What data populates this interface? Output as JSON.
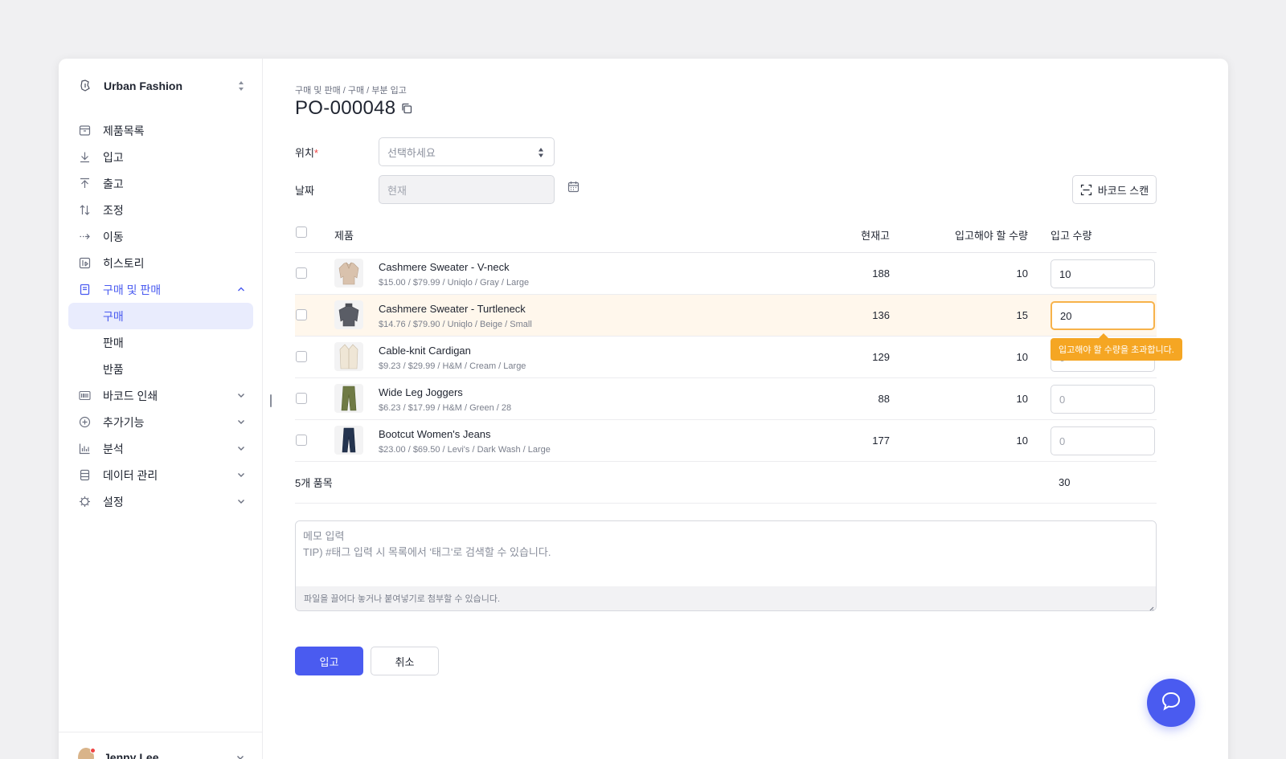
{
  "sidebar": {
    "brand": "Urban Fashion",
    "items": [
      {
        "label": "제품목록",
        "icon": "box-icon"
      },
      {
        "label": "입고",
        "icon": "arrow-down-icon"
      },
      {
        "label": "출고",
        "icon": "arrow-up-icon"
      },
      {
        "label": "조정",
        "icon": "swap-vertical-icon"
      },
      {
        "label": "이동",
        "icon": "arrow-right-icon"
      },
      {
        "label": "히스토리",
        "icon": "history-icon"
      },
      {
        "label": "구매 및 판매",
        "icon": "document-icon"
      },
      {
        "label": "바코드 인쇄",
        "icon": "barcode-icon"
      },
      {
        "label": "추가기능",
        "icon": "plus-circle-icon"
      },
      {
        "label": "분석",
        "icon": "bar-chart-icon"
      },
      {
        "label": "데이터 관리",
        "icon": "database-icon"
      },
      {
        "label": "설정",
        "icon": "gear-icon"
      }
    ],
    "sub_items": [
      "구매",
      "판매",
      "반품"
    ],
    "user": "Jenny Lee"
  },
  "header": {
    "breadcrumb": "구매 및 판매 / 구매 / 부분 입고",
    "title": "PO-000048"
  },
  "form": {
    "location_label": "위치",
    "location_required": "*",
    "location_placeholder": "선택하세요",
    "date_label": "날짜",
    "date_placeholder": "현재",
    "barcode_button": "바코드 스캔"
  },
  "table": {
    "headers": {
      "product": "제품",
      "stock": "현재고",
      "need": "입고해야 할 수량",
      "qty": "입고 수량"
    },
    "rows": [
      {
        "name": "Cashmere Sweater - V-neck",
        "meta": "$15.00 / $79.99 / Uniqlo / Gray / Large",
        "stock": "188",
        "need": "10",
        "qty": "10",
        "qty_placeholder": ""
      },
      {
        "name": "Cashmere Sweater - Turtleneck",
        "meta": "$14.76 / $79.90 / Uniqlo / Beige / Small",
        "stock": "136",
        "need": "15",
        "qty": "20",
        "qty_placeholder": ""
      },
      {
        "name": "Cable-knit Cardigan",
        "meta": "$9.23 / $29.99 / H&M / Cream / Large",
        "stock": "129",
        "need": "10",
        "qty": "",
        "qty_placeholder": "0"
      },
      {
        "name": "Wide Leg Joggers",
        "meta": "$6.23 / $17.99 / H&M / Green / 28",
        "stock": "88",
        "need": "10",
        "qty": "",
        "qty_placeholder": "0"
      },
      {
        "name": "Bootcut Women's Jeans",
        "meta": "$23.00 / $69.50 / Levi's / Dark Wash / Large",
        "stock": "177",
        "need": "10",
        "qty": "",
        "qty_placeholder": "0"
      }
    ],
    "tooltip": "입고해야 할 수량을 초과합니다.",
    "summary_count": "5개 품목",
    "summary_total": "30"
  },
  "memo": {
    "placeholder": "메모 입력\nTIP) #태그 입력 시 목록에서 '태그'로 검색할 수 있습니다.",
    "attach_hint": "파일을 끌어다 놓거나 붙여넣기로 첨부할 수 있습니다."
  },
  "actions": {
    "submit": "입고",
    "cancel": "취소"
  },
  "colors": {
    "accent": "#4a5bf0",
    "warning": "#f5a623",
    "highlight_row": "#fff7ec"
  }
}
